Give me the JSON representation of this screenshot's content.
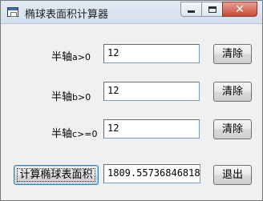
{
  "window": {
    "title": "椭球表面积计算器",
    "app_icon": "window-app-icon"
  },
  "caption": {
    "minimize_icon": "minimize-icon",
    "maximize_icon": "maximize-icon",
    "close_icon": "close-icon",
    "close_glyph": "✕"
  },
  "fields": [
    {
      "label_prefix": "半轴",
      "label_var": "a>0",
      "value": "12",
      "clear_label": "清除"
    },
    {
      "label_prefix": "半轴",
      "label_var": "b>0",
      "value": "12",
      "clear_label": "清除"
    },
    {
      "label_prefix": "半轴",
      "label_var": "c>=0",
      "value": "12",
      "clear_label": "清除"
    }
  ],
  "compute": {
    "button_label": "计算椭球表面积",
    "result": "1809.55736846818"
  },
  "exit_label": "退出"
}
